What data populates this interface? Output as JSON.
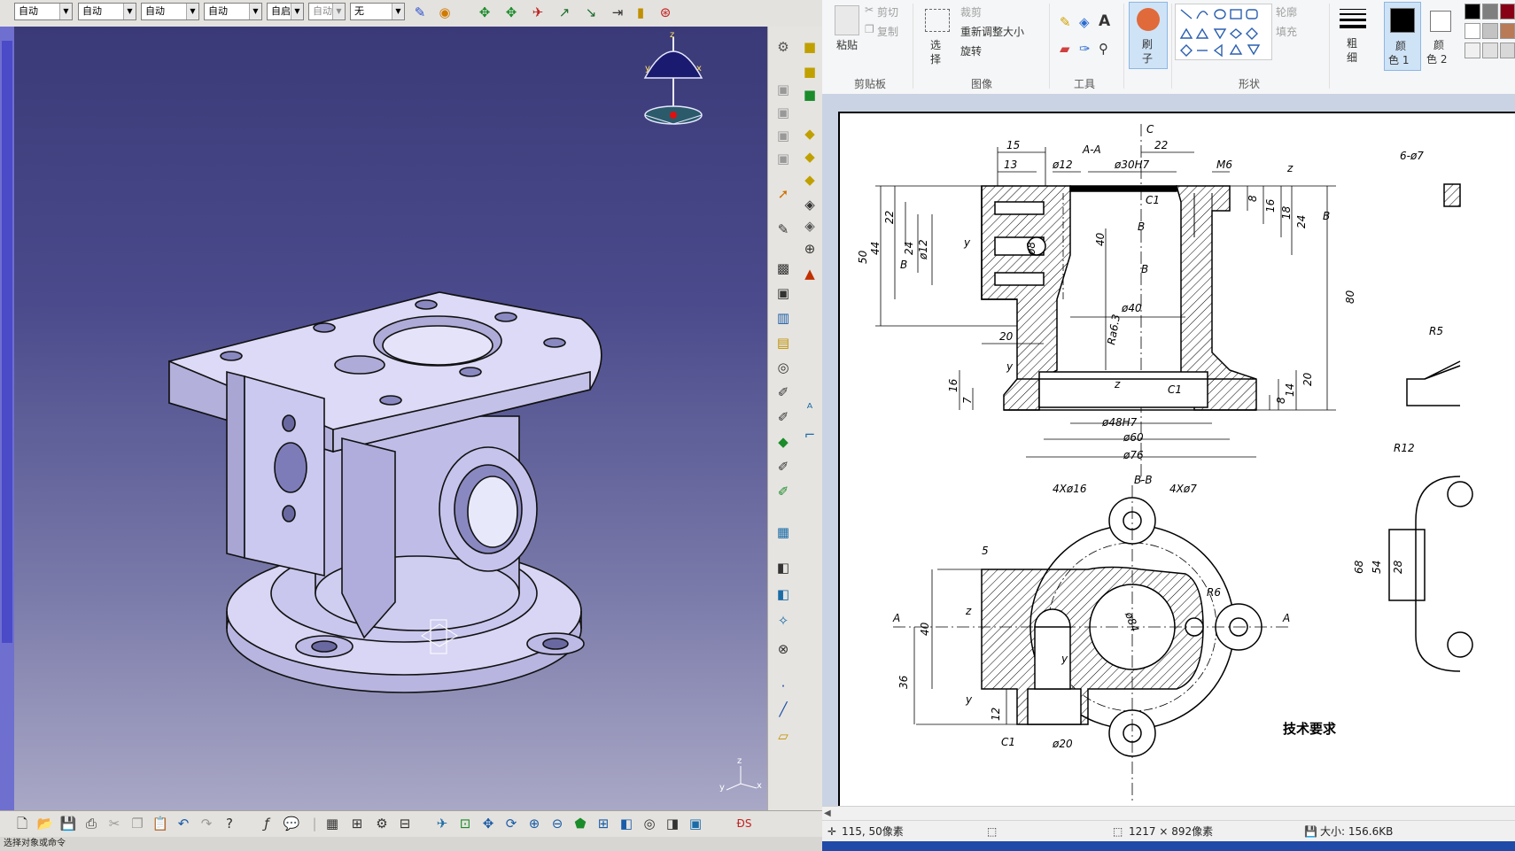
{
  "catia": {
    "toolbar_top": {
      "dropdowns": [
        "自动",
        "自动",
        "自动",
        "自动",
        "自启",
        "自动",
        "无"
      ],
      "icons": [
        "paint-brush-icon",
        "palette-icon",
        "pan-icon",
        "rotate-icon",
        "fly-icon",
        "compass-icon",
        "normal-view-icon",
        "zoom-area-icon",
        "measure-icon",
        "swap-icon"
      ]
    },
    "status_text": "选择对象或命令",
    "compass_labels": {
      "z": "z",
      "x": "x",
      "y": "y"
    },
    "axis_labels": {
      "z": "z",
      "x": "x",
      "y": "y"
    }
  },
  "paint": {
    "clipboard": {
      "paste": "粘贴",
      "cut": "剪切",
      "copy": "复制",
      "group": "剪贴板"
    },
    "image": {
      "select": "选",
      "select2": "择",
      "crop": "裁剪",
      "resize": "重新调整大小",
      "rotate": "旋转",
      "group": "图像"
    },
    "tools": {
      "group": "工具"
    },
    "brush": {
      "label1": "刷",
      "label2": "子"
    },
    "shapes": {
      "outline": "轮廓",
      "fill": "填充",
      "group": "形状"
    },
    "size": {
      "label1": "粗",
      "label2": "细"
    },
    "color1": {
      "label1": "颜",
      "label2": "色 1"
    },
    "color2": {
      "label1": "颜",
      "label2": "色 2"
    },
    "colors": {
      "primary": "#000000",
      "secondary": "#ffffff",
      "palette": [
        "#000000",
        "#7f7f7f",
        "#880015",
        "#ffffff",
        "#c3c3c3",
        "#b97a57",
        "#f0f0f0",
        "#e0e0e0",
        "#d8d8d8"
      ]
    },
    "status": {
      "cursor": "115, 50像素",
      "dimensions": "1217 × 892像素",
      "size": "大小: 156.6KB"
    }
  },
  "drawing": {
    "section_aa": "A-A",
    "section_bb": "B-B",
    "tech_req": "技术要求",
    "dims": {
      "d15": "15",
      "d13": "13",
      "d12": "ø12",
      "d30": "ø30H7",
      "d22": "22",
      "m6": "M6",
      "c": "C",
      "z": "z",
      "d50": "50",
      "d44": "44",
      "d22b": "22",
      "d24": "24",
      "d12b": "ø12",
      "d8": "ø8",
      "d40": "40",
      "d80": "80",
      "d8b": "8",
      "d16": "16",
      "d18": "18",
      "d24b": "24",
      "c1": "C1",
      "b": "B",
      "y": "y",
      "ra": "Ra6.3",
      "d40b": "ø40",
      "d20": "20",
      "d16b": "16",
      "d7": "7",
      "d48": "ø48H7",
      "d60": "ø60",
      "d76": "ø76",
      "d8c": "8",
      "d14": "14",
      "d20b": "20",
      "c1b": "C1",
      "d6x7": "6-ø7",
      "r5": "R5",
      "r12": "R12",
      "d68": "68",
      "d54": "54",
      "d28": "28",
      "d4x16": "4Xø16",
      "d4x7": "4Xø7",
      "d5": "5",
      "r6": "R6",
      "d84": "ø84",
      "a": "A",
      "d40c": "40",
      "d36": "36",
      "d12c": "12",
      "c1c": "C1",
      "d20c": "ø20"
    }
  }
}
